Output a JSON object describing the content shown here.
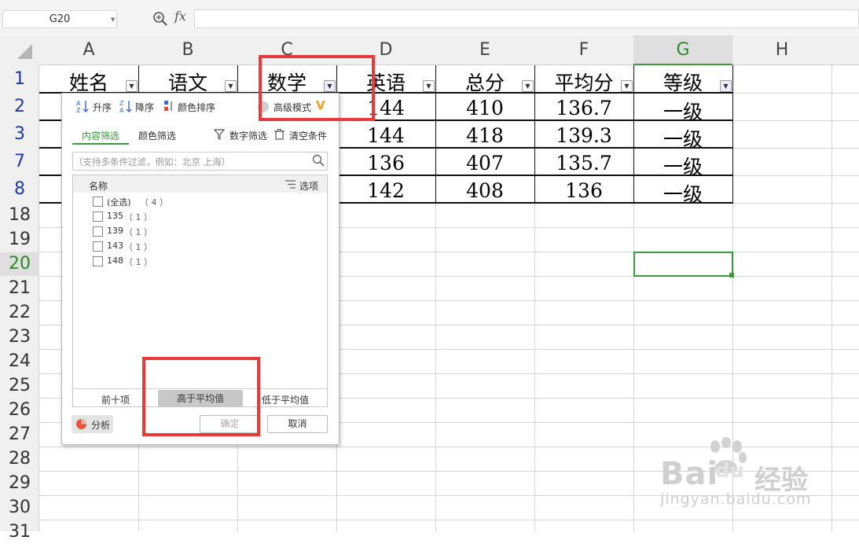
{
  "formula_bar": {
    "cell_ref": "G20",
    "fx_label": "fx",
    "formula_value": ""
  },
  "columns": [
    "A",
    "B",
    "C",
    "D",
    "E",
    "F",
    "G",
    "H"
  ],
  "active_column": "G",
  "rows": [
    "1",
    "2",
    "3",
    "7",
    "8",
    "18",
    "19",
    "20",
    "21",
    "22",
    "23",
    "24",
    "25",
    "26",
    "27",
    "28",
    "29",
    "30",
    "31"
  ],
  "active_row": "20",
  "table": {
    "headers": [
      "姓名",
      "语文",
      "数学",
      "英语",
      "总分",
      "平均分",
      "等级"
    ],
    "header_visible": {
      "col_c": "数学",
      "col_d": "英语"
    },
    "data_rows": [
      {
        "d": "144",
        "e": "410",
        "f": "136.7",
        "g": "一级"
      },
      {
        "d": "144",
        "e": "418",
        "f": "139.3",
        "g": "一级"
      },
      {
        "d": "136",
        "e": "407",
        "f": "135.7",
        "g": "一级"
      },
      {
        "d": "142",
        "e": "408",
        "f": "136",
        "g": "一级"
      }
    ]
  },
  "filter_panel": {
    "sort_asc": "升序",
    "sort_desc": "降序",
    "sort_color": "颜色排序",
    "advanced_mode": "高级模式",
    "tab_content": "内容筛选",
    "tab_color": "颜色筛选",
    "number_filter": "数字筛选",
    "clear_conditions": "清空条件",
    "search_placeholder": "（支持多条件过滤，例如：北京  上海）",
    "list_header_name": "名称",
    "list_header_options": "选项",
    "items": [
      {
        "label": "(全选)",
        "count": "（ 4 ）"
      },
      {
        "label": "135",
        "count": "（ 1 ）"
      },
      {
        "label": "139",
        "count": "（ 1 ）"
      },
      {
        "label": "143",
        "count": "（ 1 ）"
      },
      {
        "label": "148",
        "count": "（ 1 ）"
      }
    ],
    "quick_top10": "前十项",
    "quick_above_avg": "高于平均值",
    "quick_below_avg": "低于平均值",
    "analyze": "分析",
    "ok": "确定",
    "cancel": "取消"
  },
  "watermark": {
    "brand": "Bai",
    "brand_paw": "du",
    "brand_cn": "经验",
    "url": "jingyan.baidu.com"
  },
  "colors": {
    "accent_green": "#3a9b3a",
    "highlight_red": "#e83a3a",
    "row_blue": "#1c3aa9"
  }
}
